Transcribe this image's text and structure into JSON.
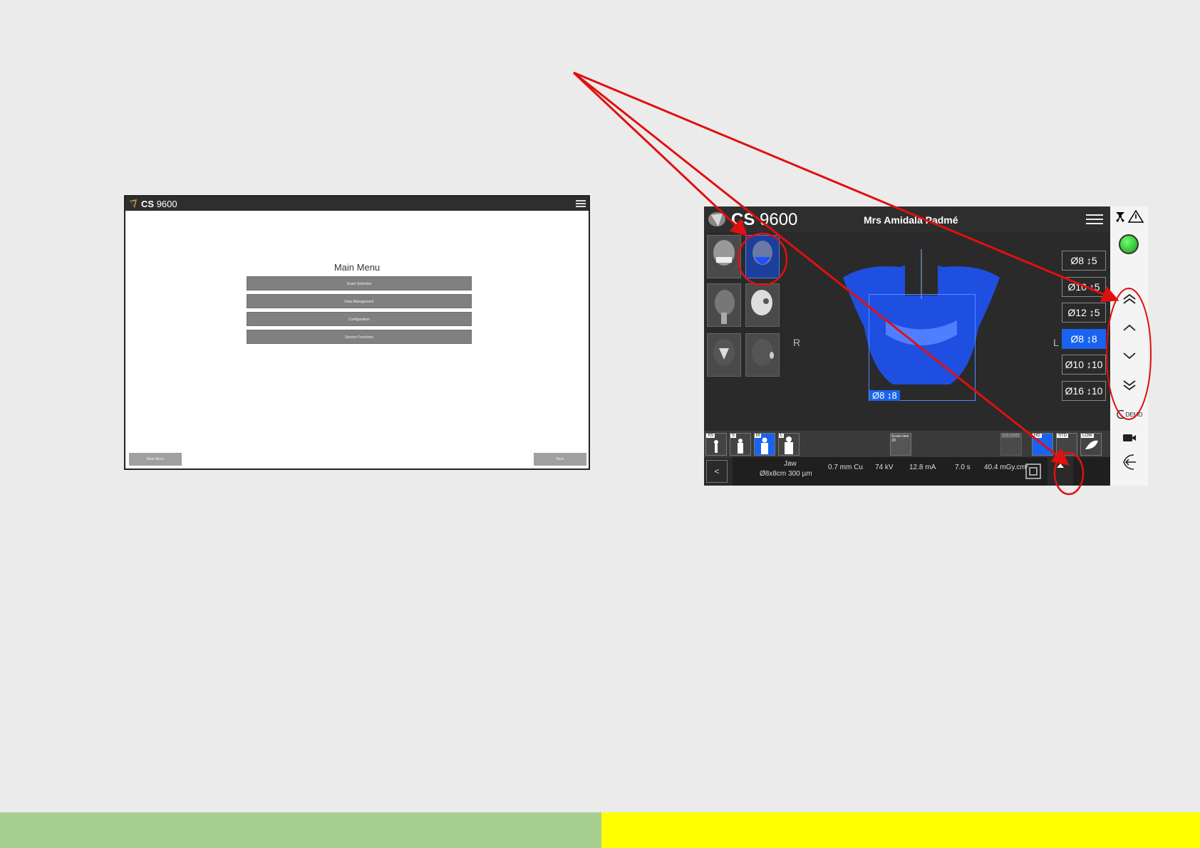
{
  "main_menu_screen": {
    "brand_prefix": "CS",
    "brand_model": "9600",
    "title": "Main Menu",
    "buttons": [
      "Exam Selection",
      "Data Management",
      "Configuration",
      "Service Functions"
    ],
    "footer_left": "Main Menu",
    "footer_right": "Back"
  },
  "exam_screen": {
    "brand_prefix": "CS",
    "brand_model": "9600",
    "patient_name": "Mrs Amidala Padmé",
    "fov_options": [
      "Ø8 ↕5",
      "Ø10 ↕5",
      "Ø12 ↕5",
      "Ø8 ↕8",
      "Ø10 ↕10",
      "Ø16 ↕10"
    ],
    "fov_selected": "Ø8 ↕8",
    "fov_overlay_label": "Ø8 ↕8",
    "side_right": "R",
    "side_left": "L",
    "position_tags": [
      "XS",
      "S",
      "M",
      "L"
    ],
    "scout_view_label": "Scout view 2D",
    "mode_tags": [
      "CS MAR",
      "HD",
      "STD",
      "LOW"
    ],
    "back_button": "<",
    "exam_region": "Jaw",
    "exam_volume": "Ø8x8cm 300 µm",
    "filter": "0.7 mm Cu",
    "kv": "74 kV",
    "ma": "12.8 mA",
    "time": "7.0 s",
    "dose": "40.4 mGy.cm²",
    "demo_label": "DEMO"
  },
  "colors": {
    "annotation": "#e01010",
    "selected_blue": "#1a63f0",
    "green_bar": "#a6cf8f",
    "yellow_bar": "#ffff00"
  }
}
